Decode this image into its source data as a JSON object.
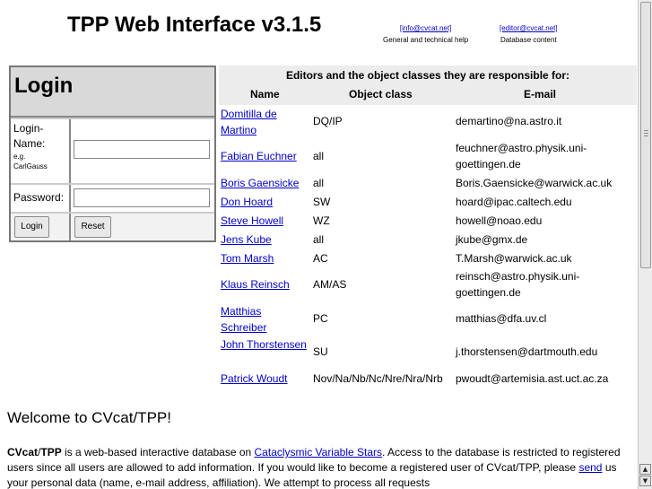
{
  "header": {
    "title": "TPP Web Interface v3.1.5",
    "contacts": [
      {
        "email": "[info@cvcat.net]",
        "desc": "General and technical help"
      },
      {
        "email": "[editor@cvcat.net]",
        "desc": "Database content"
      }
    ]
  },
  "login": {
    "heading": "Login",
    "login_label_1": "Login-",
    "login_label_2": "Name:",
    "login_hint_1": "e.g.",
    "login_hint_2": "CarlGauss",
    "login_value": "",
    "password_label": "Password:",
    "password_value": "",
    "login_button": "Login",
    "reset_button": "Reset"
  },
  "editors": {
    "caption": "Editors and the object classes they are responsible for:",
    "columns": [
      "Name",
      "Object class",
      "E-mail"
    ],
    "rows": [
      {
        "name": "Domitilla de Martino",
        "class": "DQ/IP",
        "email": "demartino@na.astro.it"
      },
      {
        "name": "Fabian Euchner",
        "class": "all",
        "email": "feuchner@astro.physik.uni-goettingen.de"
      },
      {
        "name": "Boris Gaensicke",
        "class": "all",
        "email": "Boris.Gaensicke@warwick.ac.uk"
      },
      {
        "name": "Don Hoard",
        "class": "SW",
        "email": "hoard@ipac.caltech.edu"
      },
      {
        "name": "Steve Howell",
        "class": "WZ",
        "email": "howell@noao.edu"
      },
      {
        "name": "Jens Kube",
        "class": "all",
        "email": "jkube@gmx.de"
      },
      {
        "name": "Tom Marsh",
        "class": "AC",
        "email": "T.Marsh@warwick.ac.uk"
      },
      {
        "name": "Klaus Reinsch",
        "class": "AM/AS",
        "email": "reinsch@astro.physik.uni-goettingen.de"
      },
      {
        "name": "Matthias Schreiber",
        "class": "PC",
        "email": "matthias@dfa.uv.cl"
      },
      {
        "name": "John Thorstensen",
        "class": "SU",
        "email": "j.thorstensen@dartmouth.edu"
      },
      {
        "name": "Patrick Woudt",
        "class": "Nov/Na/Nb/Nc/Nre/Nra/Nrb",
        "email": "pwoudt@artemisia.ast.uct.ac.za"
      }
    ]
  },
  "welcome": {
    "heading": "Welcome to CVcat/TPP!",
    "p1_brand_a": "CVcat",
    "p1_slash": "/",
    "p1_brand_b": "TPP",
    "p1_text_a": " is a web-based interactive database on ",
    "p1_link_a": "Cataclysmic Variable Stars",
    "p1_text_b": ". Access to the database is restricted to registered users since all users are allowed to add information. If you would like to become a registered user of CVcat/TPP, please ",
    "p1_link_b": "send",
    "p1_text_c": " us your personal data (name, e-mail address, affiliation). We attempt to process all requests"
  },
  "scrollbar": {
    "up_icon": "▲",
    "down_icon": "▼"
  },
  "colors": {
    "link": "#0000cc",
    "panel": "#ececec"
  }
}
